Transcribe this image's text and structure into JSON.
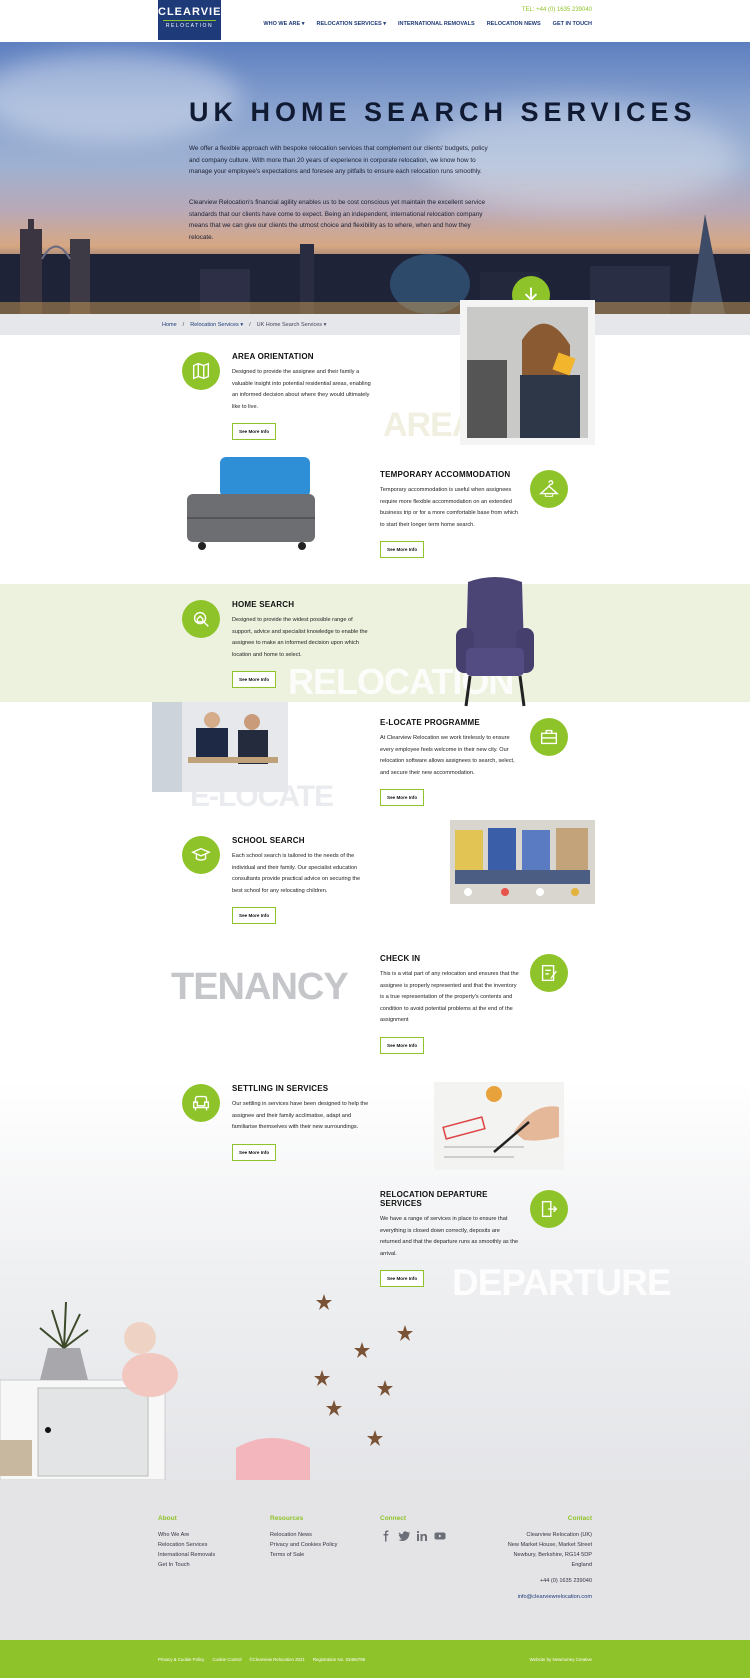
{
  "header": {
    "logo_name": "CLEARVIEW",
    "logo_sub": "RELOCATION",
    "tel": "TEL: +44 (0) 1635 239040",
    "nav": [
      "WHO WE ARE",
      "RELOCATION SERVICES",
      "INTERNATIONAL REMOVALS",
      "RELOCATION NEWS",
      "GET IN TOUCH"
    ]
  },
  "hero": {
    "title": "UK HOME SEARCH SERVICES",
    "p1": "We offer a flexible approach with bespoke relocation services that complement our clients' budgets, policy and company culture. With more than 20 years of experience in corporate relocation, we know how to manage your employee's expectations and foresee any pitfalls to ensure each relocation runs smoothly.",
    "p2": "Clearview Relocation's financial agility enables us to be cost conscious yet maintain the excellent service standards that our clients have come to expect. Being an independent, international relocation company means that we can give our clients the utmost choice and flexibility as to where, when and how they relocate."
  },
  "breadcrumb": {
    "home": "Home",
    "sep": "/",
    "level2": "Relocation Services",
    "level3": "UK Home Search Services"
  },
  "services": [
    {
      "title": "AREA ORIENTATION",
      "text": "Designed to provide the assignee and their family a valuable insight into potential residential areas, enabling an informed decision about where they would ultimately like to live.",
      "button": "See More Info",
      "icon": "map-icon"
    },
    {
      "title": "TEMPORARY ACCOMMODATION",
      "text": "Temporary accommodation is useful when assignees require more flexible accommodation on an extended business trip or for a more comfortable base from which to start their longer term home search.",
      "button": "See More Info",
      "icon": "hanger-icon"
    },
    {
      "title": "HOME SEARCH",
      "text": "Designed to provide the widest possible range of support, advice and specialist knowledge to enable the assignee to make an informed decision upon which location and home to select.",
      "button": "See More Info",
      "icon": "home-search-icon"
    },
    {
      "title": "E-LOCATE PROGRAMME",
      "text": "At Clearview Relocation we work tirelessly to ensure every employee feels welcome in their new city. Our relocation software allows assignees to search, select, and secure their new accommodation.",
      "button": "See More Info",
      "icon": "briefcase-icon"
    },
    {
      "title": "SCHOOL SEARCH",
      "text": "Each school search is tailored to the needs of the individual and their family. Our specialist education consultants provide practical advice on securing the best school for any relocating children.",
      "button": "See More Info",
      "icon": "school-icon"
    },
    {
      "title": "CHECK IN",
      "text": "This is a vital part of any relocation and ensures that the assignee is properly represented and that the inventory is a true representation of the property's contents and condition to avoid potential problems at the end of the assignment",
      "button": "See More Info",
      "icon": "checklist-icon"
    },
    {
      "title": "SETTLING IN SERVICES",
      "text": "Our settling in services have been designed to help the assignee and their family acclimatise, adapt and familiarise themselves with their new surroundings.",
      "button": "See More Info",
      "icon": "armchair-icon"
    },
    {
      "title": "RELOCATION DEPARTURE SERVICES",
      "text": "We have a range of services in place to ensure that everything is closed down correctly, deposits are returned and that the departure runs as smoothly as the arrival.",
      "button": "See More Info",
      "icon": "exit-icon"
    }
  ],
  "ghost_words": {
    "area": "AREA",
    "relocation": "RELOCATION",
    "elocate": "E-LOCATE",
    "tenancy": "TENANCY",
    "departure": "DEPARTURE"
  },
  "footer": {
    "about_title": "About",
    "about_links": [
      "Who We Are",
      "Relocation Services",
      "International Removals",
      "Get In Touch"
    ],
    "resources_title": "Resources",
    "resources_links": [
      "Relocation News",
      "Privacy and Cookies Policy",
      "Terms of Sale"
    ],
    "connect_title": "Connect",
    "social_icons": [
      "facebook-icon",
      "twitter-icon",
      "linkedin-icon",
      "youtube-icon"
    ],
    "contact_title": "Contact",
    "address_lines": [
      "Clearview Relocation (UK)",
      "New Market House, Market Street",
      "Newbury, Berkshire, RG14 5DP",
      "England"
    ],
    "phone": "+44 (0) 1635 239040",
    "email": "info@clearviewrelocation.com"
  },
  "bottom_bar": {
    "links": [
      "Privacy & Cookie Policy",
      "Cookie Control",
      "©Clearview Relocation 2021",
      "Registration No. 03456789"
    ],
    "credit": "Website by Newmoney Creative"
  },
  "colors": {
    "brand_navy": "#1e3a78",
    "accent_green": "#8fc32a",
    "band_green": "#ecf2de"
  }
}
